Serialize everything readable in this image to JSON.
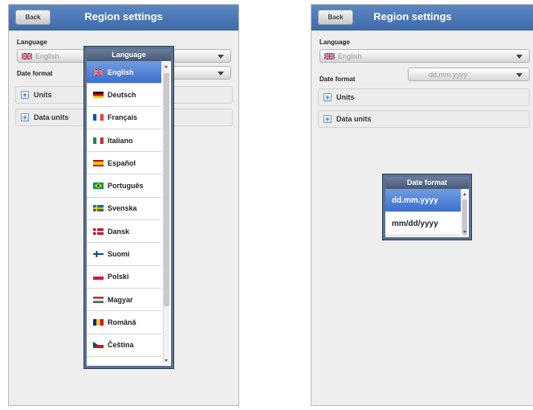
{
  "left_screen": {
    "back_label": "Back",
    "title": "Region settings",
    "language_label": "Language",
    "language_value": "English",
    "date_format_label": "Date format",
    "units_label": "Units",
    "data_units_label": "Data units"
  },
  "language_popup": {
    "title": "Language",
    "options": [
      "English",
      "Deutsch",
      "Français",
      "Italiano",
      "Español",
      "Português",
      "Svenska",
      "Dansk",
      "Suomi",
      "Polski",
      "Magyar",
      "Română",
      "Čeština"
    ],
    "selected": "English"
  },
  "right_screen": {
    "back_label": "Back",
    "title": "Region settings",
    "language_label": "Language",
    "language_value": "English",
    "date_format_label": "Date format",
    "date_format_value": "dd.mm.yyyy",
    "units_label": "Units",
    "data_units_label": "Data units"
  },
  "date_popup": {
    "title": "Date format",
    "options": [
      "dd.mm.yyyy",
      "mm/dd/yyyy"
    ],
    "selected": "dd.mm.yyyy"
  },
  "icons": {
    "expand": "plus-icon",
    "dropdown": "chevron-down-icon"
  },
  "colors": {
    "header": "#4a76b5",
    "selection": "#4f7fd8"
  }
}
